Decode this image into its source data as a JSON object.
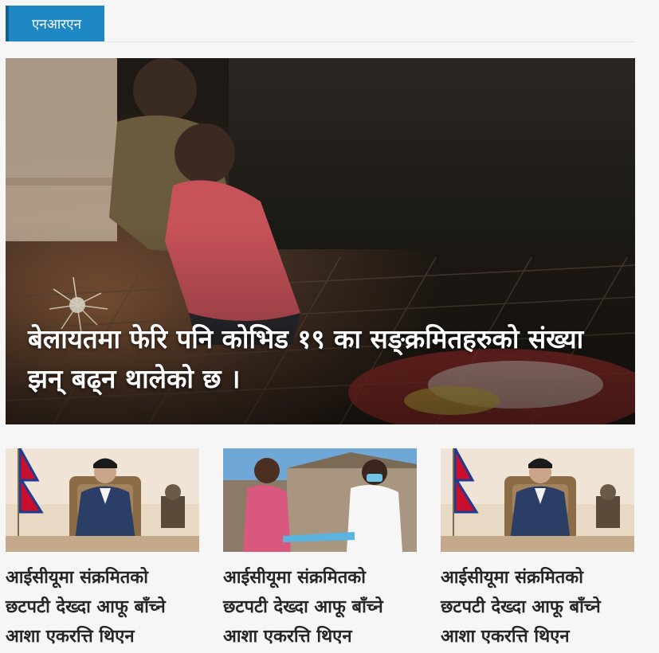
{
  "section": {
    "label": "एनआरएन"
  },
  "hero": {
    "headline": "बेलायतमा फेरि पनि कोभिड १९ का सङ्क्रमितहरुको संख्या झन् बढ्न थालेको छ ।",
    "image_icon": "children-sparkler-photo"
  },
  "cards": [
    {
      "title": "आईसीयूमा संक्रमितको छटपटी देख्दा आफू बाँच्ने आशा एकरत्ति थिएन",
      "image_icon": "prime-minister-portrait-photo"
    },
    {
      "title": "आईसीयूमा संक्रमितको छटपटी देख्दा आफू बाँच्ने आशा एकरत्ति थिएन",
      "image_icon": "mask-distribution-photo"
    },
    {
      "title": "आईसीयूमा संक्रमितको छटपटी देख्दा आफू बाँच्ने आशा एकरत्ति थिएन",
      "image_icon": "prime-minister-portrait-photo"
    }
  ],
  "colors": {
    "accent": "#1e88c4",
    "background": "#f6f6f6"
  }
}
